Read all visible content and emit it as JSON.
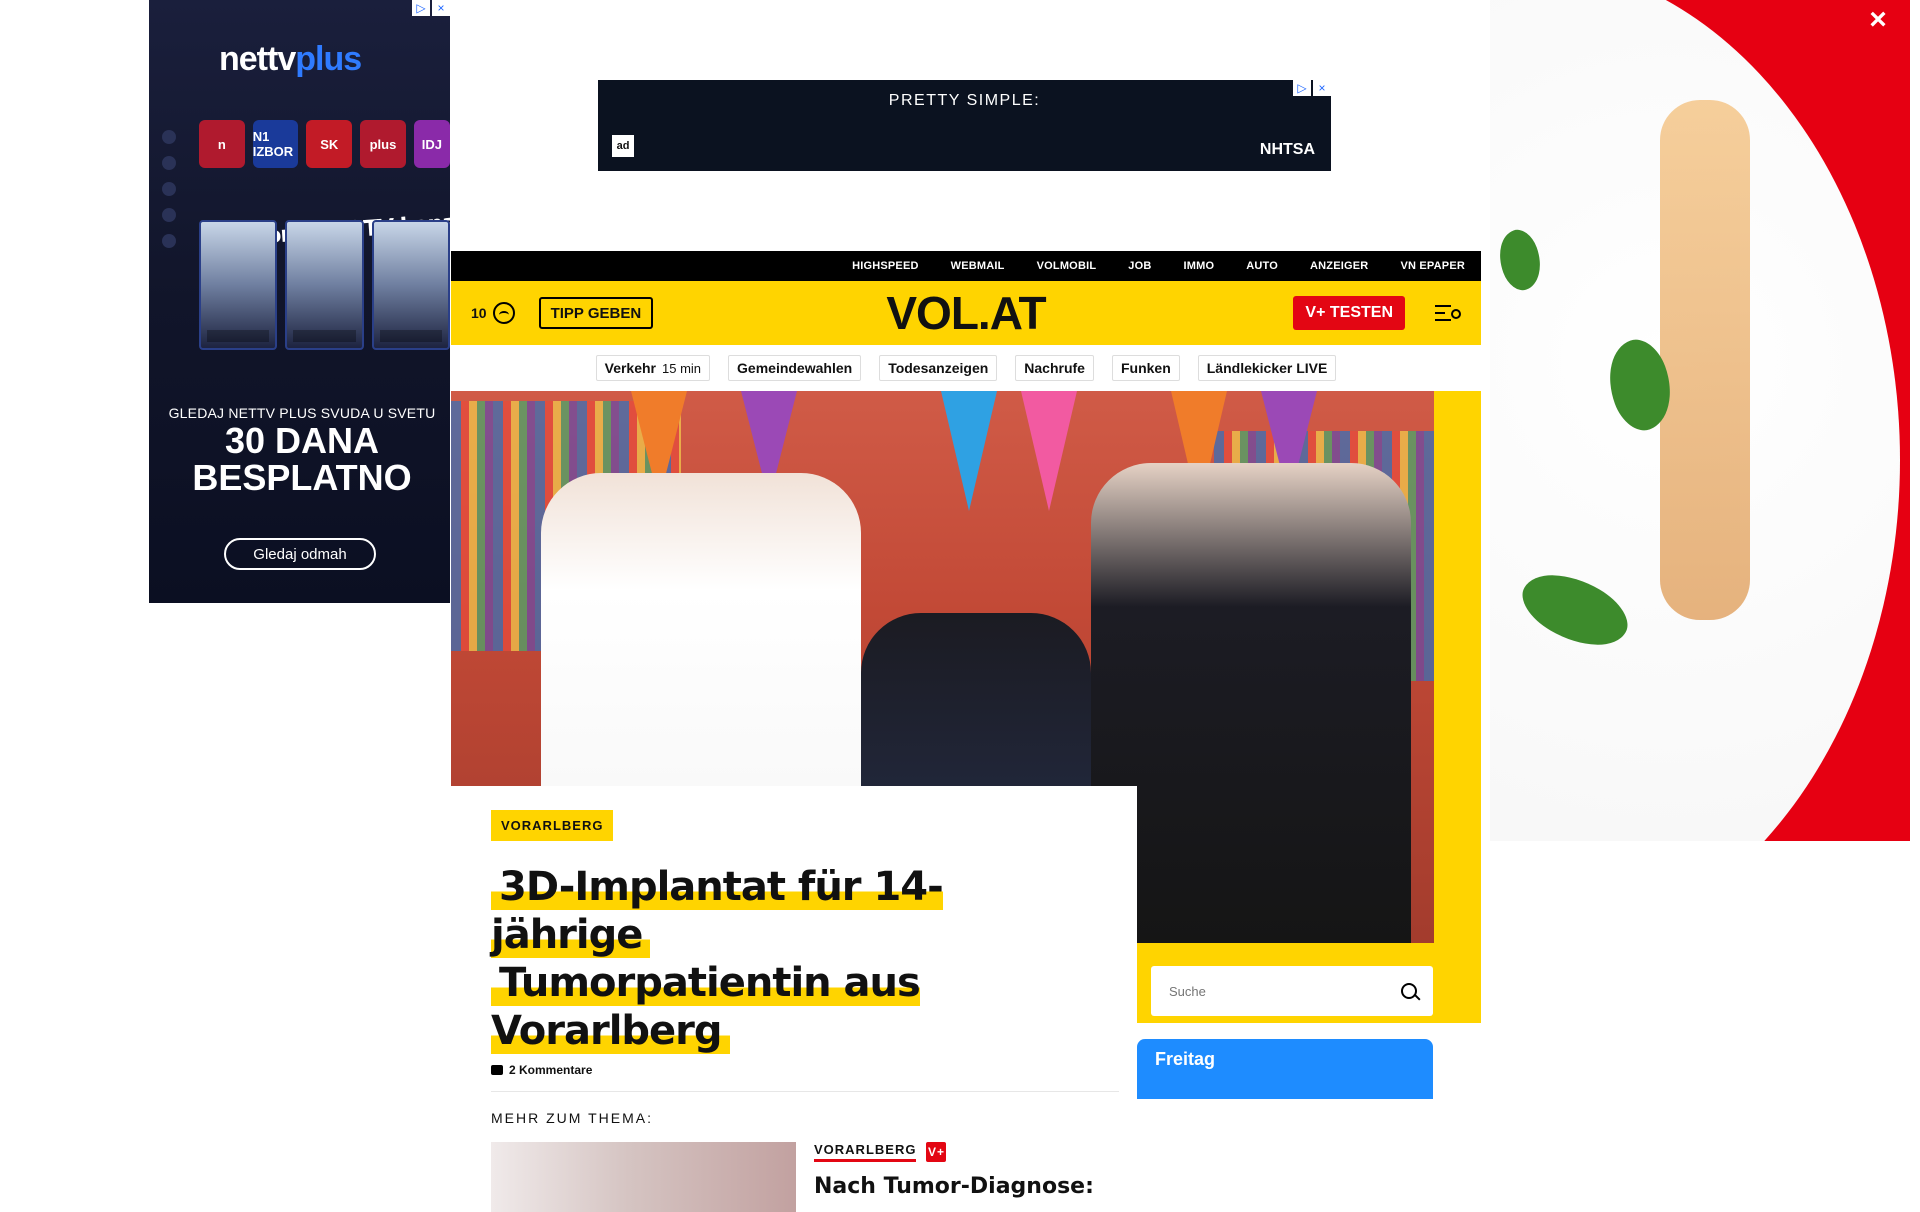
{
  "left_ad": {
    "brand": "nettv",
    "brand_plus": "plus",
    "channels": [
      "n",
      "N1 IZBOR",
      "SK",
      "plus",
      "IDJ"
    ],
    "headline": "Tvoji omiljeni TV kanali",
    "promo_line": "GLEDAJ NETTV PLUS SVUDA U SVETU",
    "promo_big": "30 DANA BESPLATNO",
    "cta": "Gledaj odmah"
  },
  "top_ad": {
    "title": "PRETTY SIMPLE:",
    "badge": "ad",
    "brand": "NHTSA"
  },
  "right_ad": {
    "close": "×"
  },
  "nav": {
    "top_links": [
      "HIGHSPEED",
      "WEBMAIL",
      "VOLMOBIL",
      "JOB",
      "IMMO",
      "AUTO",
      "ANZEIGER",
      "VN EPAPER"
    ],
    "notif_count": "10",
    "tip_button": "TIPP GEBEN",
    "logo": "VOL.AT",
    "vplus_button": "V+ TESTEN"
  },
  "quick_links": [
    {
      "label": "Verkehr",
      "sub": "15 min"
    },
    {
      "label": "Gemeindewahlen"
    },
    {
      "label": "Todesanzeigen"
    },
    {
      "label": "Nachrufe"
    },
    {
      "label": "Funken"
    },
    {
      "label": "Ländlekicker LIVE"
    }
  ],
  "article": {
    "category": "VORARLBERG",
    "headline_line1": "3D-Implantat für 14-jährige",
    "headline_line2": "Tumorpatientin aus Vorarlberg",
    "comments": "2 Kommentare",
    "more_title": "MEHR ZUM THEMA:",
    "related_category": "VORARLBERG",
    "related_vplus": "V+",
    "related_title": "Nach Tumor-Diagnose:"
  },
  "search": {
    "placeholder": "Suche"
  },
  "weather": {
    "day": "Freitag"
  }
}
